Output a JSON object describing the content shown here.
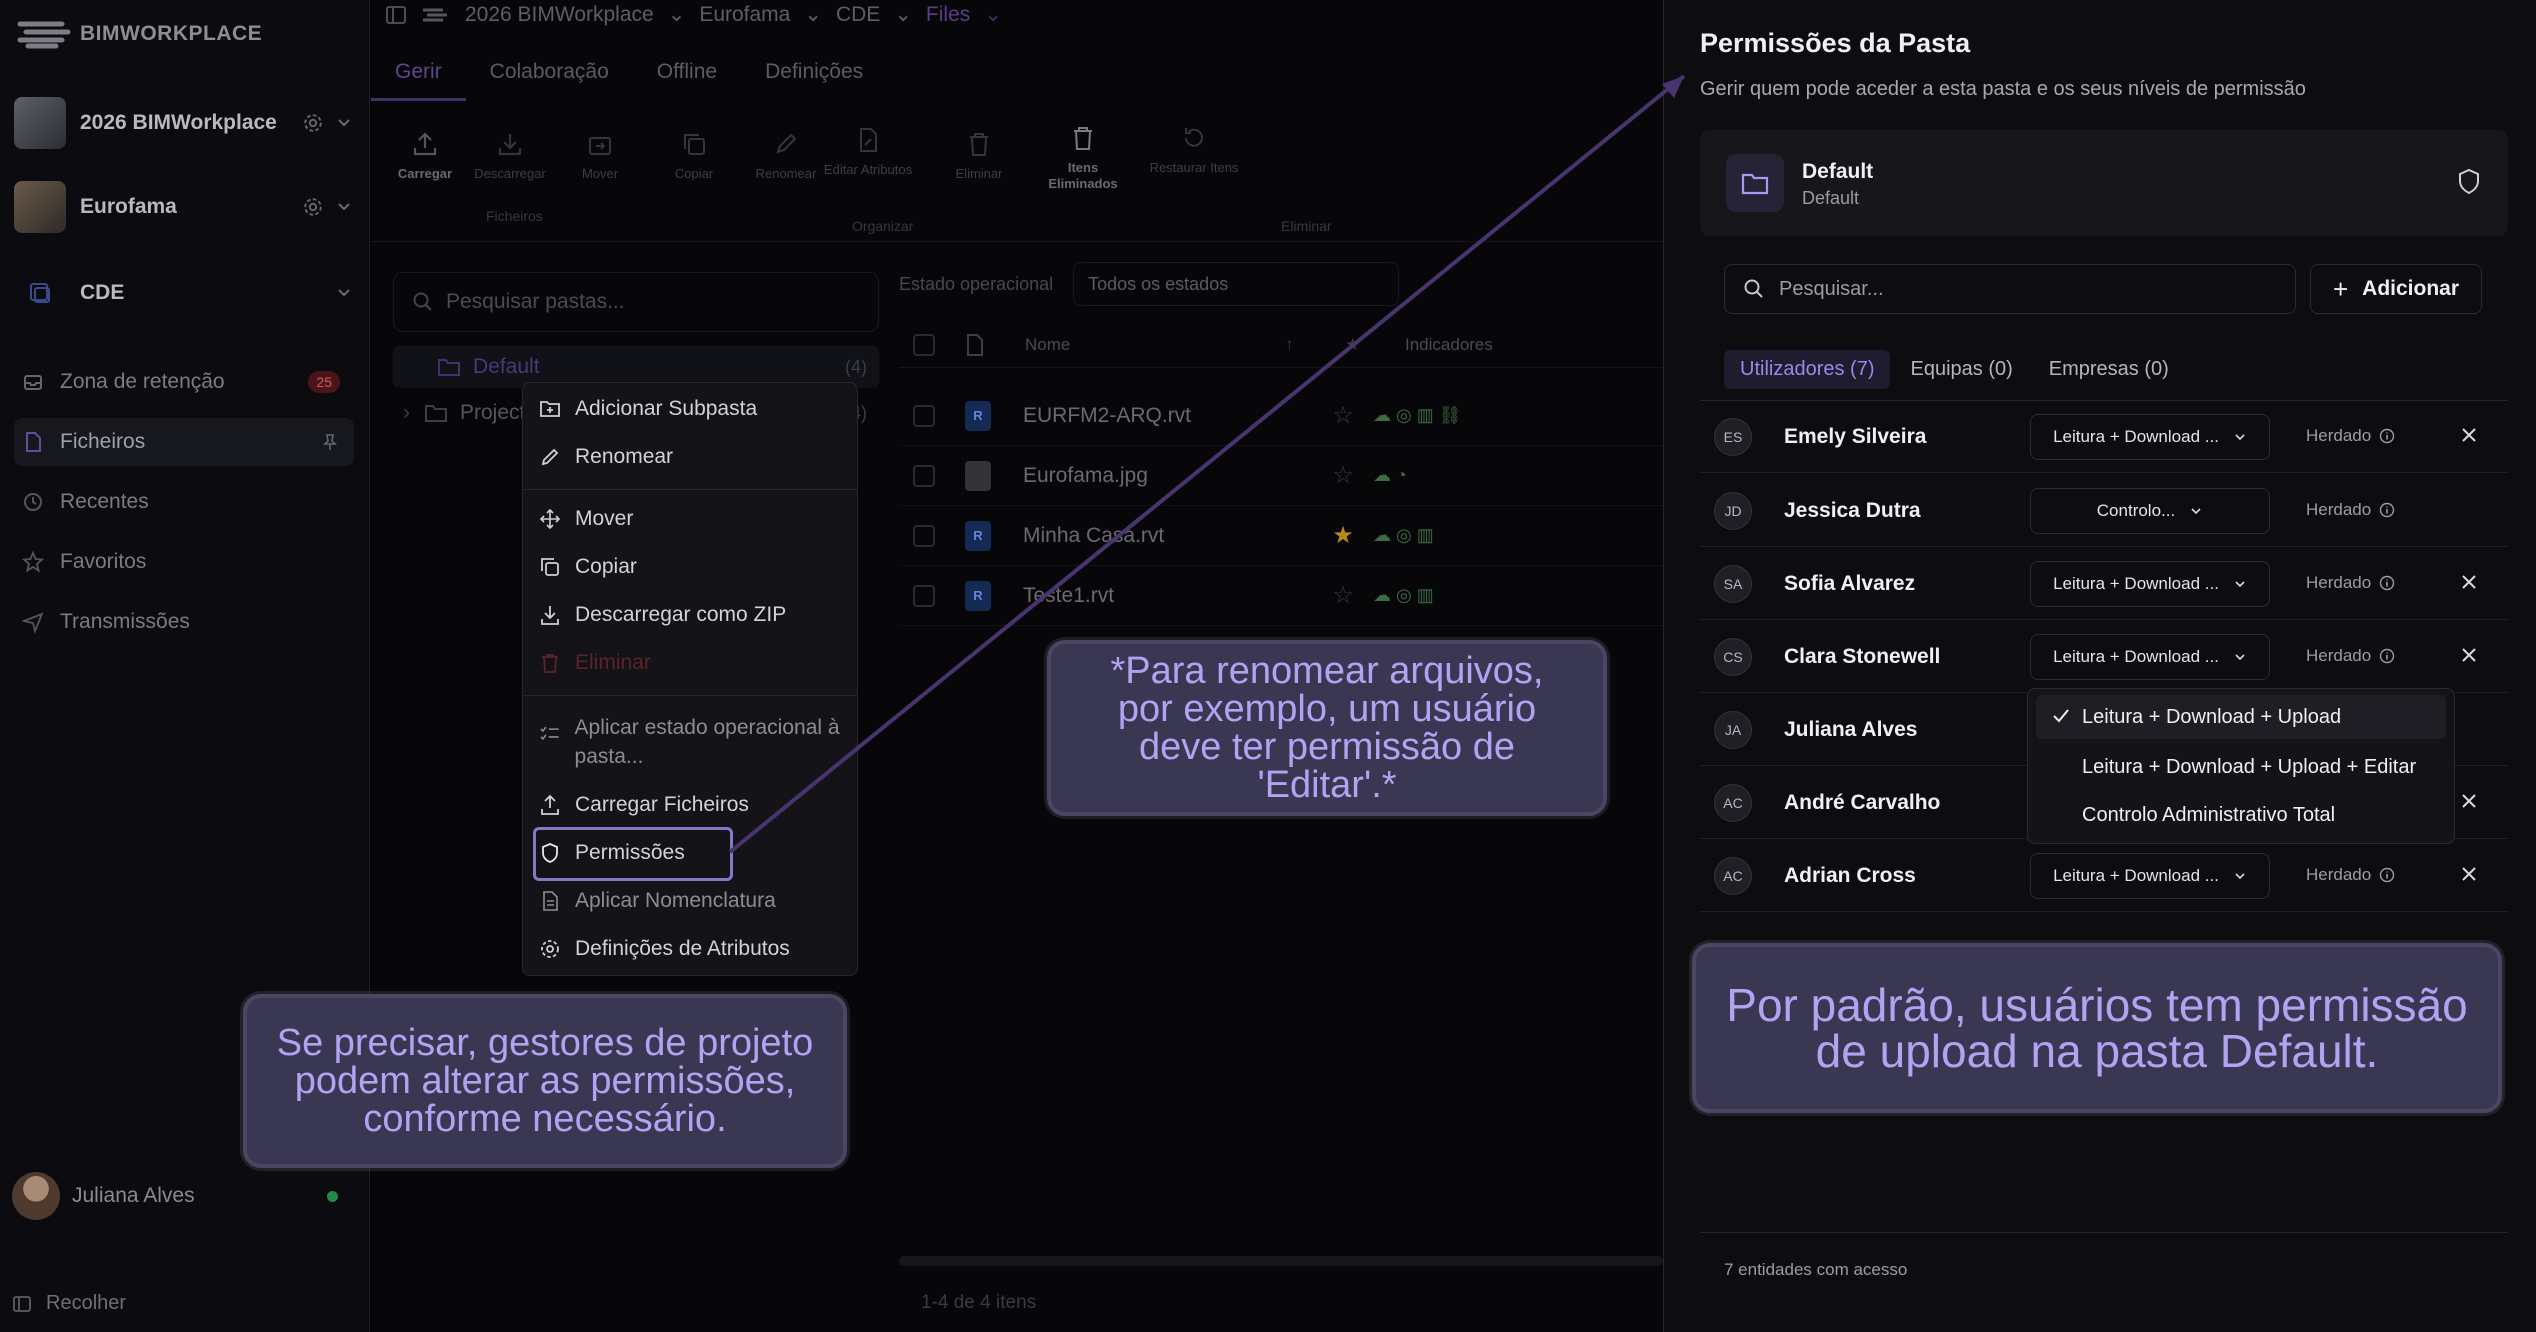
{
  "sidebar": {
    "brand": "BIMWORKPLACE",
    "projects": [
      {
        "label": "2026 BIMWorkplace"
      },
      {
        "label": "Eurofama"
      },
      {
        "label": "CDE"
      }
    ],
    "nav": [
      {
        "label": "Zona de retenção",
        "badge": "25"
      },
      {
        "label": "Ficheiros"
      },
      {
        "label": "Recentes"
      },
      {
        "label": "Favoritos"
      },
      {
        "label": "Transmissões"
      }
    ],
    "user": "Juliana Alves",
    "collapse": "Recolher"
  },
  "main": {
    "breadcrumb": [
      "2026 BIMWorkplace",
      "Eurofama",
      "CDE",
      "Files"
    ],
    "tabs": [
      "Gerir",
      "Colaboração",
      "Offline",
      "Definições"
    ],
    "ribbon": {
      "upload": "Carregar",
      "download": "Descarregar",
      "move": "Mover",
      "copy": "Copiar",
      "rename": "Renomear",
      "edit_attrs": "Editar Atributos",
      "delete": "Eliminar",
      "deleted_items": "Itens Eliminados",
      "restore": "Restaurar Itens",
      "group_files": "Ficheiros",
      "group_organize": "Organizar",
      "group_delete": "Eliminar"
    },
    "folder_search_placeholder": "Pesquisar pastas...",
    "tree": [
      {
        "label": "Default",
        "count": "(4)"
      },
      {
        "label": "Project",
        "count": "(4)"
      }
    ],
    "status_label": "Estado operacional",
    "status_value": "Todos os estados",
    "columns": {
      "name": "Nome",
      "indicators": "Indicadores"
    },
    "files": [
      {
        "name": "EURFM2-ARQ.rvt",
        "type": "R",
        "starred": false
      },
      {
        "name": "Eurofama.jpg",
        "type": "",
        "starred": false
      },
      {
        "name": "Minha Casa.rvt",
        "type": "R",
        "starred": true
      },
      {
        "name": "Teste1.rvt",
        "type": "R",
        "starred": false
      }
    ],
    "footer": "1-4 de 4 itens"
  },
  "context_menu": {
    "items": [
      "Adicionar Subpasta",
      "Renomear",
      "Mover",
      "Copiar",
      "Descarregar como ZIP",
      "Eliminar",
      "Aplicar estado operacional à pasta...",
      "Carregar Ficheiros",
      "Permissões",
      "Aplicar Nomenclatura",
      "Definições de Atributos"
    ]
  },
  "panel": {
    "title": "Permissões da Pasta",
    "subtitle": "Gerir quem pode aceder a esta pasta e os seus níveis de permissão",
    "folder_name": "Default",
    "folder_sub": "Default",
    "search_placeholder": "Pesquisar...",
    "add_label": "Adicionar",
    "tabs": [
      "Utilizadores (7)",
      "Equipas (0)",
      "Empresas (0)"
    ],
    "users": [
      {
        "initials": "ES",
        "name": "Emely Silveira",
        "perm": "Leitura + Download ...",
        "inherited": "Herdado",
        "removable": true
      },
      {
        "initials": "JD",
        "name": "Jessica Dutra",
        "perm": "Controlo...",
        "inherited": "Herdado",
        "removable": false
      },
      {
        "initials": "SA",
        "name": "Sofia Alvarez",
        "perm": "Leitura + Download ...",
        "inherited": "Herdado",
        "removable": true
      },
      {
        "initials": "CS",
        "name": "Clara Stonewell",
        "perm": "Leitura + Download ...",
        "inherited": "Herdado",
        "removable": true
      },
      {
        "initials": "JA",
        "name": "Juliana Alves",
        "perm": "",
        "inherited": "",
        "removable": false
      },
      {
        "initials": "AC",
        "name": "André Carvalho",
        "perm": "",
        "inherited": "",
        "removable": true
      },
      {
        "initials": "AC",
        "name": "Adrian Cross",
        "perm": "Leitura + Download ...",
        "inherited": "Herdado",
        "removable": true
      }
    ],
    "dropdown_options": [
      {
        "label": "Leitura + Download + Upload",
        "selected": true
      },
      {
        "label": "Leitura + Download + Upload + Editar",
        "selected": false
      },
      {
        "label": "Controlo Administrativo Total",
        "selected": false
      }
    ],
    "footer": "7 entidades com acesso"
  },
  "annotations": {
    "rename_note": "*Para renomear arquivos, por exemplo, um usuário deve ter permissão de 'Editar'.*",
    "managers_note": "Se precisar, gestores de projeto podem alterar as permissões, conforme necessário.",
    "default_note": "Por padrão, usuários tem permissão de upload na pasta Default."
  },
  "colors": {
    "accent": "#8a76c9",
    "callout_bg": "#3a3752",
    "callout_text": "#b0a4f2",
    "arrow": "#4a3470"
  }
}
